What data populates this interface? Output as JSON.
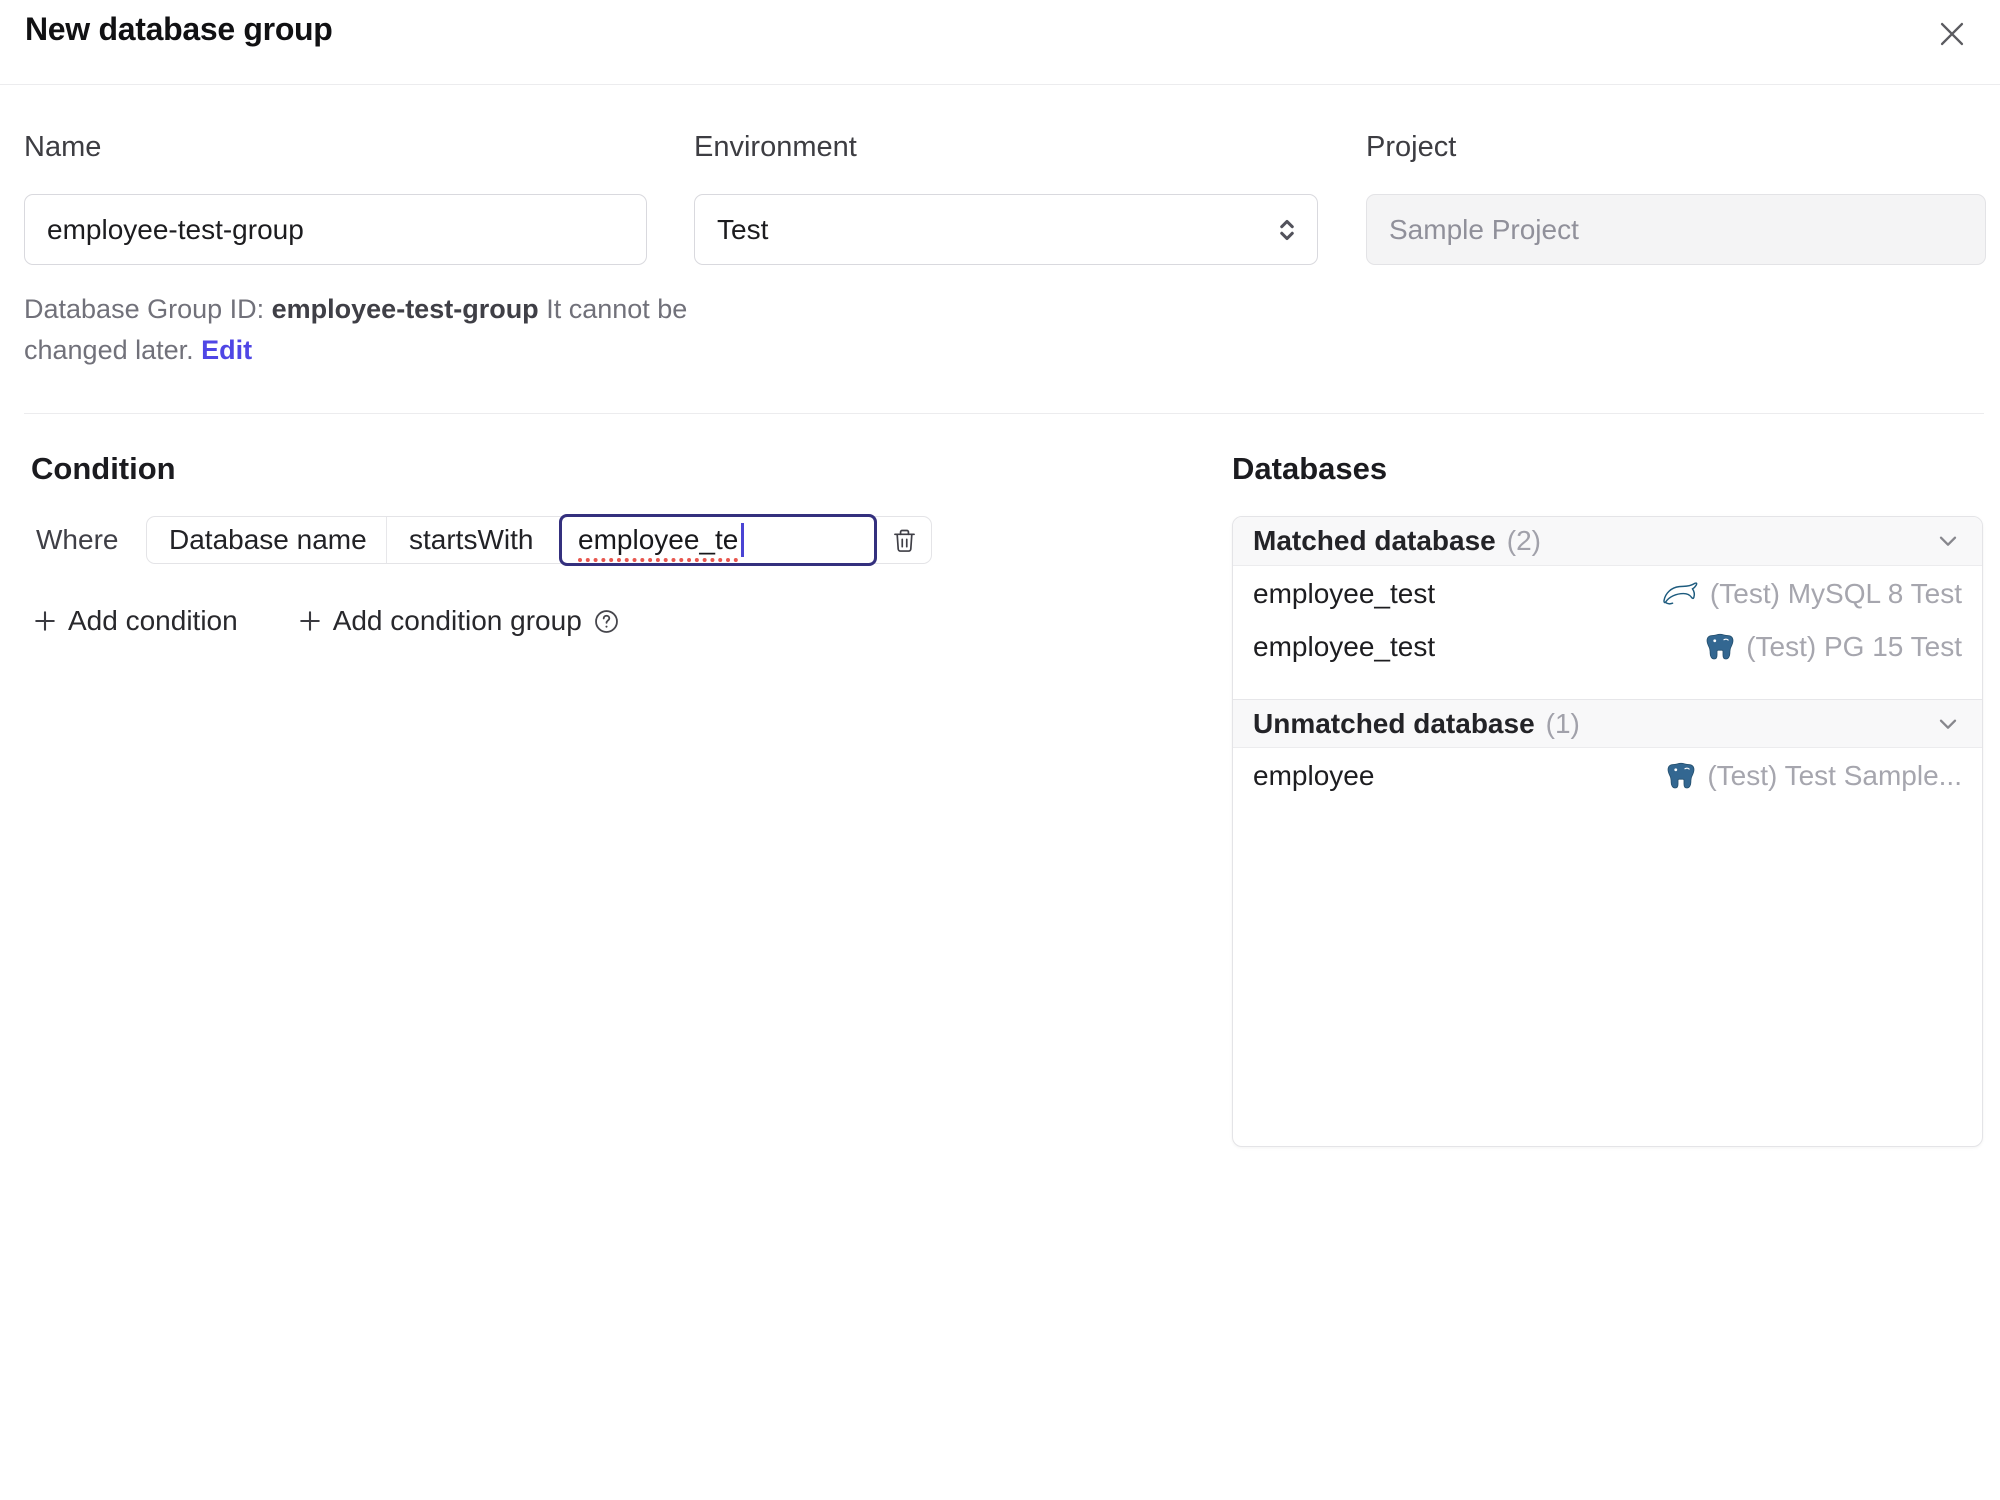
{
  "header": {
    "title": "New database group"
  },
  "form": {
    "name": {
      "label": "Name",
      "value": "employee-test-group"
    },
    "environment": {
      "label": "Environment",
      "value": "Test"
    },
    "project": {
      "label": "Project",
      "value": "Sample Project"
    },
    "id_hint": {
      "prefix": "Database Group ID: ",
      "id": "employee-test-group",
      "suffix": " It cannot be changed later. ",
      "edit_label": "Edit"
    }
  },
  "condition": {
    "heading": "Condition",
    "where_label": "Where",
    "field_selected": "Database name",
    "operator_selected": "startsWith",
    "value": "employee_te",
    "add_condition_label": "Add condition",
    "add_condition_group_label": "Add condition group"
  },
  "databases": {
    "heading": "Databases",
    "groups": {
      "matched": {
        "title": "Matched database",
        "count": "(2)",
        "rows": [
          {
            "name": "employee_test",
            "instance": "(Test) MySQL 8 Test",
            "engine": "mysql"
          },
          {
            "name": "employee_test",
            "instance": "(Test) PG 15 Test",
            "engine": "postgres"
          }
        ]
      },
      "unmatched": {
        "title": "Unmatched database",
        "count": "(1)",
        "rows": [
          {
            "name": "employee",
            "instance": "(Test) Test Sample...",
            "engine": "postgres"
          }
        ]
      }
    }
  },
  "colors": {
    "accent": "#4f46e5",
    "focus_border": "#34307e",
    "mysql_icon": "#1d5b7e",
    "postgres_icon": "#336791",
    "spellcheck_underline": "#e8574f"
  }
}
